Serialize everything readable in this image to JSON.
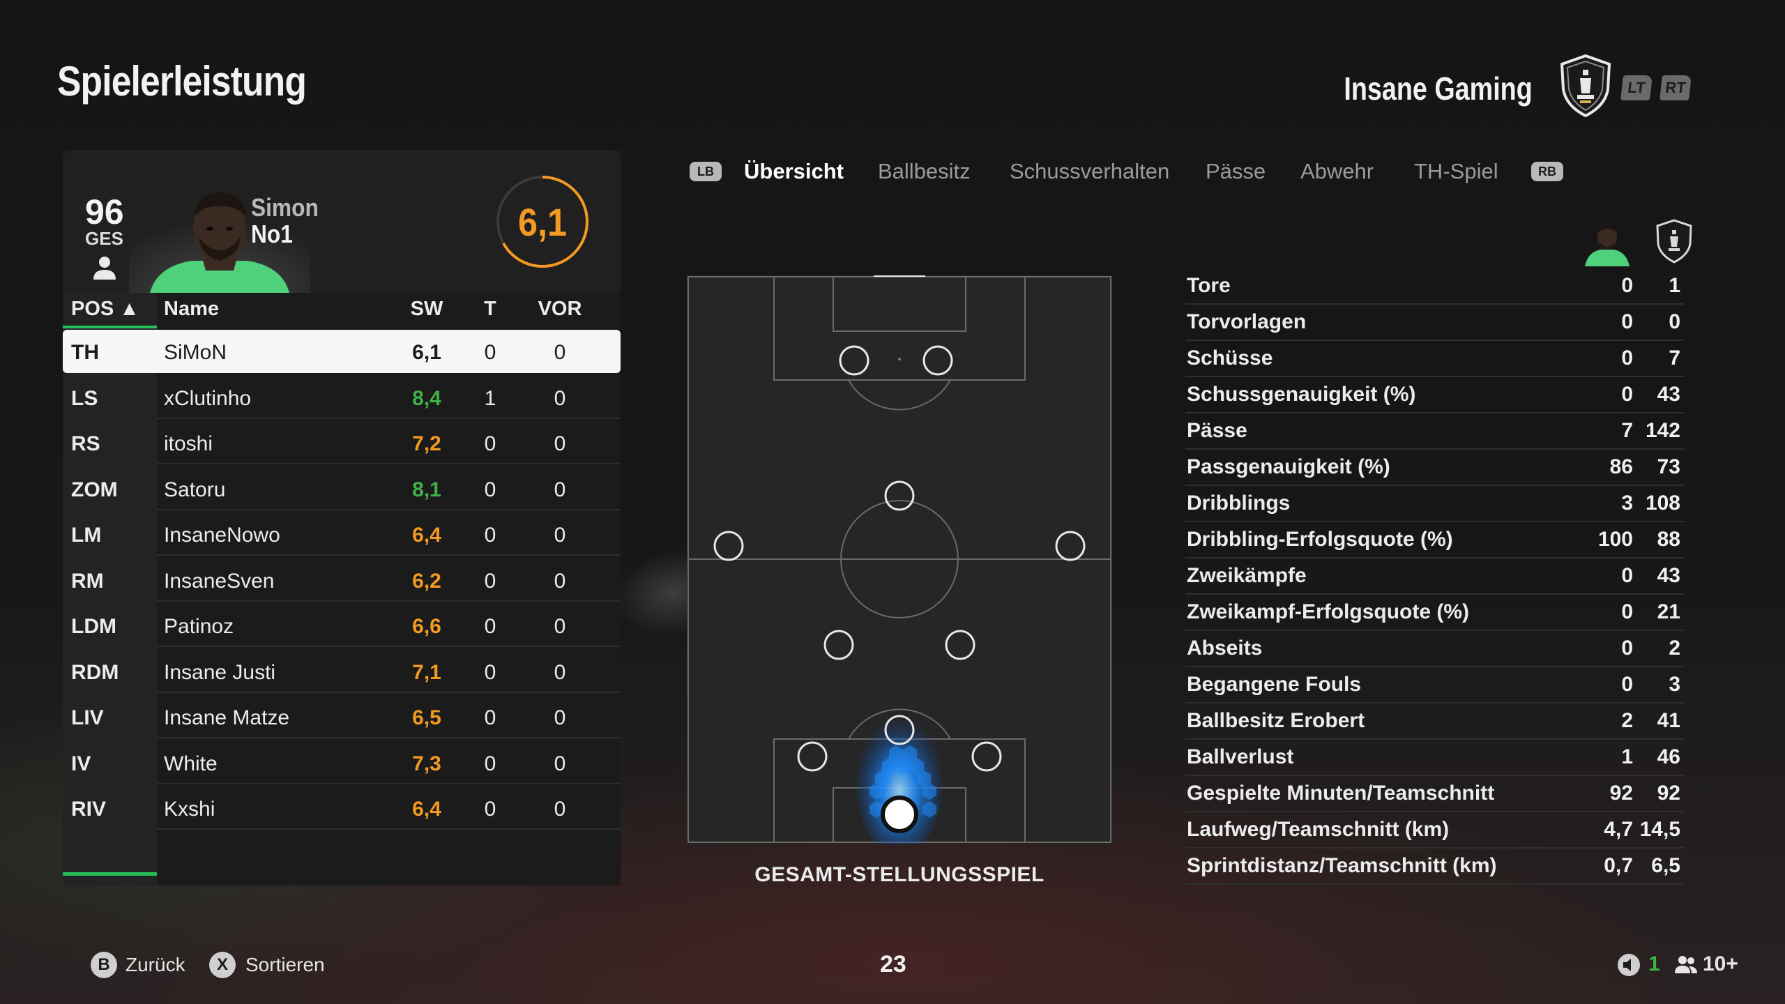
{
  "header": {
    "title": "Spielerleistung",
    "team_name": "Insane Gaming",
    "lt_label": "LT",
    "rt_label": "RT"
  },
  "player": {
    "overall": "96",
    "overall_label": "GES",
    "first_name": "Simon",
    "last_name": "No1",
    "rating": "6,1",
    "rating_color": "#f29a21"
  },
  "table": {
    "headers": {
      "pos": "POS ▲",
      "name": "Name",
      "sw": "SW",
      "t": "T",
      "vor": "VOR"
    },
    "rows": [
      {
        "pos": "TH",
        "name": "SiMoN",
        "sw": "6,1",
        "sw_color": "#1c1c1c",
        "t": "0",
        "vor": "0"
      },
      {
        "pos": "LS",
        "name": "xClutinho",
        "sw": "8,4",
        "sw_color": "#3fb24a",
        "t": "1",
        "vor": "0"
      },
      {
        "pos": "RS",
        "name": "itoshi",
        "sw": "7,2",
        "sw_color": "#f29a21",
        "t": "0",
        "vor": "0"
      },
      {
        "pos": "ZOM",
        "name": "Satoru",
        "sw": "8,1",
        "sw_color": "#3fb24a",
        "t": "0",
        "vor": "0"
      },
      {
        "pos": "LM",
        "name": "InsaneNowo",
        "sw": "6,4",
        "sw_color": "#f29a21",
        "t": "0",
        "vor": "0"
      },
      {
        "pos": "RM",
        "name": "InsaneSven",
        "sw": "6,2",
        "sw_color": "#f29a21",
        "t": "0",
        "vor": "0"
      },
      {
        "pos": "LDM",
        "name": "Patinoz",
        "sw": "6,6",
        "sw_color": "#f29a21",
        "t": "0",
        "vor": "0"
      },
      {
        "pos": "RDM",
        "name": "Insane Justi",
        "sw": "7,1",
        "sw_color": "#f29a21",
        "t": "0",
        "vor": "0"
      },
      {
        "pos": "LIV",
        "name": "Insane Matze",
        "sw": "6,5",
        "sw_color": "#f29a21",
        "t": "0",
        "vor": "0"
      },
      {
        "pos": "IV",
        "name": "White",
        "sw": "7,3",
        "sw_color": "#f29a21",
        "t": "0",
        "vor": "0"
      },
      {
        "pos": "RIV",
        "name": "Kxshi",
        "sw": "6,4",
        "sw_color": "#f29a21",
        "t": "0",
        "vor": "0"
      }
    ]
  },
  "tabs": {
    "lb_label": "LB",
    "rb_label": "RB",
    "items": [
      "Übersicht",
      "Ballbesitz",
      "Schussverhalten",
      "Pässe",
      "Abwehr",
      "TH-Spiel"
    ],
    "active": "Übersicht"
  },
  "pitch": {
    "caption": "GESAMT-STELLUNGSSPIEL"
  },
  "stats": [
    {
      "label": "Tore",
      "player": "0",
      "team": "1"
    },
    {
      "label": "Torvorlagen",
      "player": "0",
      "team": "0"
    },
    {
      "label": "Schüsse",
      "player": "0",
      "team": "7"
    },
    {
      "label": "Schussgenauigkeit (%)",
      "player": "0",
      "team": "43"
    },
    {
      "label": "Pässe",
      "player": "7",
      "team": "142"
    },
    {
      "label": "Passgenauigkeit (%)",
      "player": "86",
      "team": "73"
    },
    {
      "label": "Dribblings",
      "player": "3",
      "team": "108"
    },
    {
      "label": "Dribbling-Erfolgsquote (%)",
      "player": "100",
      "team": "88"
    },
    {
      "label": "Zweikämpfe",
      "player": "0",
      "team": "43"
    },
    {
      "label": "Zweikampf-Erfolgsquote (%)",
      "player": "0",
      "team": "21"
    },
    {
      "label": "Abseits",
      "player": "0",
      "team": "2"
    },
    {
      "label": "Begangene Fouls",
      "player": "0",
      "team": "3"
    },
    {
      "label": "Ballbesitz Erobert",
      "player": "2",
      "team": "41"
    },
    {
      "label": "Ballverlust",
      "player": "1",
      "team": "46"
    },
    {
      "label": "Gespielte Minuten/Teamschnitt",
      "player": "92",
      "team": "92"
    },
    {
      "label": "Laufweg/Teamschnitt (km)",
      "player": "4,7",
      "team": "14,5"
    },
    {
      "label": "Sprintdistanz/Teamschnitt (km)",
      "player": "0,7",
      "team": "6,5"
    }
  ],
  "footer": {
    "back_button": "B",
    "back_label": "Zurück",
    "sort_button": "X",
    "sort_label": "Sortieren",
    "center_number": "23",
    "voice_count": "1",
    "party_count": "10+"
  },
  "colors": {
    "accent_green": "#23c05a",
    "rating_orange": "#f29a21",
    "rating_green": "#3fb24a",
    "heatmap_blue": "#1e8cff"
  }
}
